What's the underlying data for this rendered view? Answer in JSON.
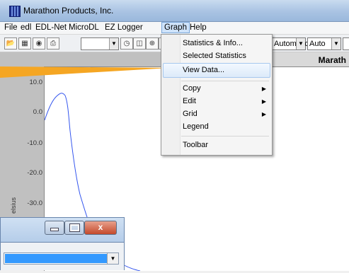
{
  "window": {
    "title": "Marathon Products, Inc."
  },
  "menubar": {
    "items": [
      "File",
      "edl",
      "EDL-Net",
      "MicroDL",
      "EZ Logger",
      "Graph",
      "Help"
    ]
  },
  "toolbar": {
    "combo_scale": "Automatic",
    "combo_auto": "Auto",
    "icons": [
      "open-icon",
      "chart-icon",
      "camera-icon",
      "print-icon",
      "clock-icon",
      "preview-icon",
      "crosshair-icon",
      "data-icon"
    ]
  },
  "plot": {
    "title": "Marath",
    "yticks": [
      "10.0",
      "0.0",
      "-10.0",
      "-20.0",
      "-30.0"
    ],
    "ylabel": "elsius"
  },
  "graph_menu": {
    "items": [
      {
        "label": "Statistics & Info...",
        "submenu": false
      },
      {
        "label": "Selected Statistics",
        "submenu": false
      },
      {
        "label": "View Data...",
        "submenu": false,
        "highlighted": true
      },
      {
        "label": "Copy",
        "submenu": true
      },
      {
        "label": "Edit",
        "submenu": true
      },
      {
        "label": "Grid",
        "submenu": true
      },
      {
        "label": "Legend",
        "submenu": false
      },
      {
        "label": "Toolbar",
        "submenu": false
      }
    ]
  },
  "callout": {
    "color": "#f5a623"
  },
  "series_color": "#3355ee"
}
